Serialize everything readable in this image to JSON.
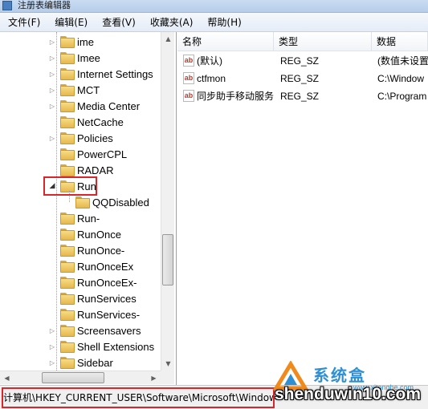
{
  "window": {
    "title": "注册表编辑器"
  },
  "menu": [
    "文件(F)",
    "编辑(E)",
    "查看(V)",
    "收藏夹(A)",
    "帮助(H)"
  ],
  "tree": {
    "nodes": [
      {
        "label": "ime",
        "expandable": true
      },
      {
        "label": "Imee",
        "expandable": true
      },
      {
        "label": "Internet Settings",
        "expandable": true
      },
      {
        "label": "MCT",
        "expandable": true
      },
      {
        "label": "Media Center",
        "expandable": true
      },
      {
        "label": "NetCache",
        "expandable": false
      },
      {
        "label": "Policies",
        "expandable": true
      },
      {
        "label": "PowerCPL",
        "expandable": false
      },
      {
        "label": "RADAR",
        "expandable": false
      },
      {
        "label": "Run",
        "expandable": true,
        "expanded": true,
        "selected": true
      },
      {
        "label": "QQDisabled",
        "expandable": false,
        "child": true
      },
      {
        "label": "Run-",
        "expandable": false
      },
      {
        "label": "RunOnce",
        "expandable": false
      },
      {
        "label": "RunOnce-",
        "expandable": false
      },
      {
        "label": "RunOnceEx",
        "expandable": false
      },
      {
        "label": "RunOnceEx-",
        "expandable": false
      },
      {
        "label": "RunServices",
        "expandable": false
      },
      {
        "label": "RunServices-",
        "expandable": false
      },
      {
        "label": "Screensavers",
        "expandable": true
      },
      {
        "label": "Shell Extensions",
        "expandable": true
      },
      {
        "label": "Sidebar",
        "expandable": true
      }
    ]
  },
  "columns": [
    "名称",
    "类型",
    "数据"
  ],
  "values": [
    {
      "name": "(默认)",
      "type": "REG_SZ",
      "data": "(数值未设置"
    },
    {
      "name": "ctfmon",
      "type": "REG_SZ",
      "data": "C:\\Window"
    },
    {
      "name": "同步助手移动服务",
      "type": "REG_SZ",
      "data": "C:\\Program"
    }
  ],
  "value_icon_text": "ab",
  "status": {
    "path": "计算机\\HKEY_CURRENT_USER\\Software\\Microsoft\\Windows"
  },
  "watermark": {
    "cn": "系统盒",
    "sub": "www.xitonghe.com",
    "domain": "shenduwin10.com"
  },
  "colors": {
    "highlight_box": "#d9262b",
    "folder": "#e6b84d"
  }
}
